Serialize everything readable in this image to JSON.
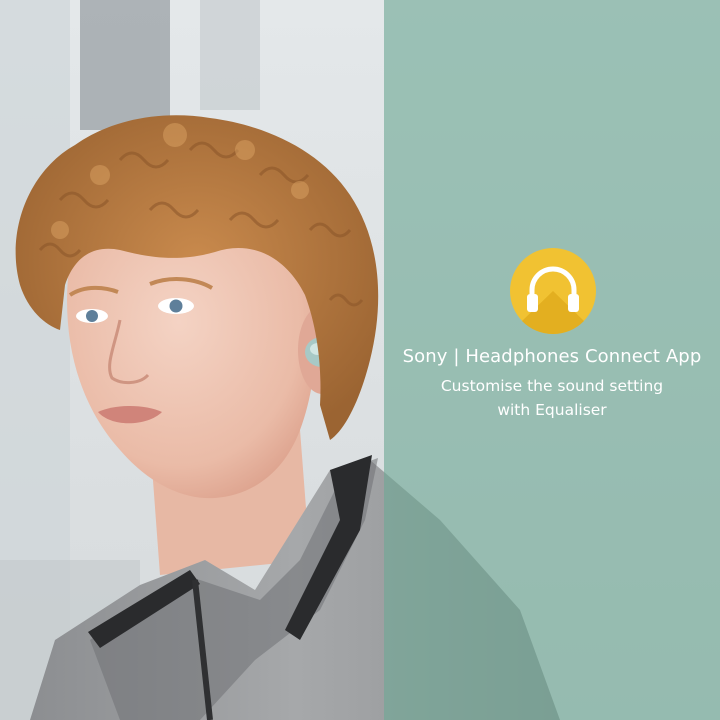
{
  "overlay": {
    "title": "Sony | Headphones Connect App",
    "subtitle_line1": "Customise the sound setting",
    "subtitle_line2": "with Equaliser"
  },
  "icons": {
    "app_icon": "headphones-icon",
    "earbud": "earbud-icon"
  },
  "colors": {
    "overlay": "#6ea894",
    "app_icon_bg": "#f1c232",
    "text": "#ffffff"
  }
}
